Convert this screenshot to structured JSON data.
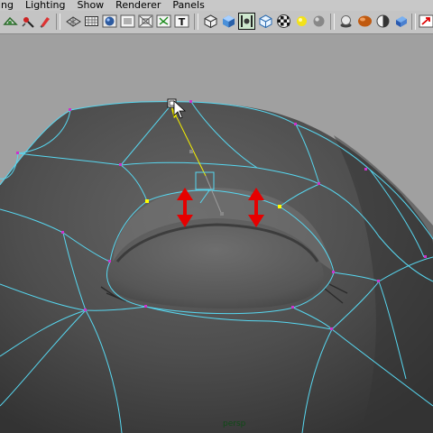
{
  "menu": [
    "ing",
    "Lighting",
    "Show",
    "Renderer",
    "Panels"
  ],
  "toolbar_icons": [
    "camera-attribute-icon",
    "select-camera-icon",
    "bookmark-icon",
    "wireframe-icon",
    "bounding-box-icon",
    "smooth-shade-icon",
    "flat-shade-icon",
    "xray-icon",
    "texture-display-icon",
    "display-text-icon",
    "isolate-icon",
    "shaded-cube-icon",
    "frame-selection-icon",
    "texture-cube-icon",
    "checker-icon",
    "yellow-light-icon",
    "grey-sphere-icon",
    "default-light-icon",
    "orange-sphere-icon",
    "half-sphere-icon",
    "blue-cube-icon",
    "red-arrow-icon"
  ],
  "viewport": {
    "camera_label": "persp",
    "background_color": "#a0a0a0",
    "wire_color": "#57d7f0"
  },
  "annotation": {
    "arrow_color": "#e60000",
    "direction": "up-down"
  }
}
